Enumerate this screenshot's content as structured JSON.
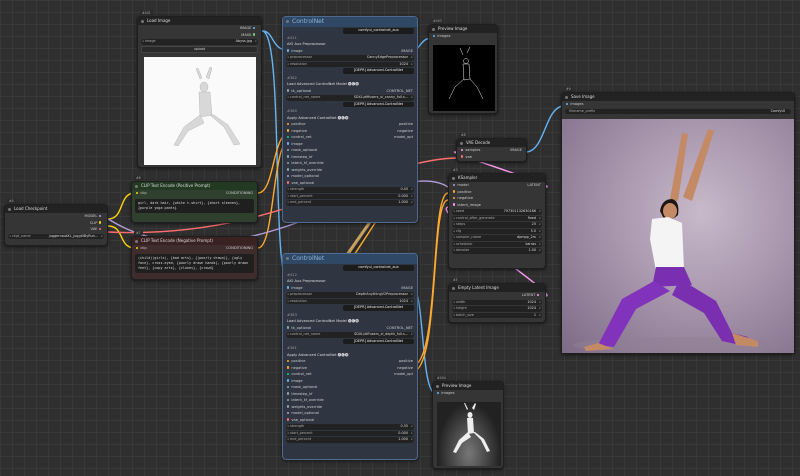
{
  "nodes": {
    "load_image": {
      "id": "#401",
      "title": "Load Image",
      "out1": "IMAGE",
      "out2": "MASK",
      "image_label": "image",
      "image_value": "Abyss.jpg",
      "upload_label": "upload"
    },
    "load_checkpoint": {
      "id": "#4",
      "title": "Load Checkpoint",
      "out1": "MODEL",
      "out2": "CLIP",
      "out3": "VAE",
      "ckpt_label": "ckpt_name",
      "ckpt_value": "juggernautXL_juggXIByRun..."
    },
    "clip_pos": {
      "id": "#6",
      "title": "CLIP Text Encode (Positive Prompt)",
      "in": "clip",
      "out": "CONDITIONING",
      "text": "girl, dark hair, {white t-shirt}, {short sleeves}, {purple yoga pants}"
    },
    "clip_neg": {
      "id": "#7",
      "title": "CLIP Text Encode (Negative Prompt)",
      "in": "clip",
      "out": "CONDITIONING",
      "text": "(child)(girls), {bad arts}, {(poorly drawn)}, {ugly face}, cross-eyed, {poorly drawn hands}, {poorly drawn feet}, {copy arts}, {clones}, {crowd}"
    },
    "group1": {
      "title": "ControlNet",
      "header_label": "comfyui_controlnet_aux",
      "id": "#411",
      "aux": {
        "title": "AIO Aux Preprocessor",
        "in": "image",
        "out": "IMAGE",
        "pre_label": "preprocessor",
        "pre_value": "CannyEdgePreprocessor",
        "res_label": "resolution",
        "res_value": "1024"
      },
      "header2": "[DEPR] Advanced-ControlNet",
      "id2": "#382",
      "loader": {
        "title": "Load Advanced ControlNet Model",
        "tag": "🅐🅒🅝",
        "in": "tk_optional",
        "out": "CONTROL_NET",
        "name_label": "control_net_name",
        "name_value": "SDXL\\diffusers_xl_canny_full.s..."
      },
      "header3": "[DEPR] Advanced-ControlNet",
      "id3": "#380",
      "apply": {
        "title": "Apply Advanced ControlNet",
        "tag": "🅐🅒🅝",
        "inputs": [
          "positive",
          "negative",
          "control_net",
          "image",
          "mask_optional",
          "timestep_kf",
          "latent_kf_override",
          "weights_override",
          "model_optional",
          "vae_optional"
        ],
        "outputs": [
          "positive",
          "negative",
          "model_opt"
        ],
        "strength_label": "strength",
        "strength_value": "0.45",
        "start_label": "start_percent",
        "start_value": "0.000",
        "end_label": "end_percent",
        "end_value": "1.000"
      }
    },
    "group2": {
      "title": "ControlNet",
      "header_label": "comfyui_controlnet_aux",
      "id": "#412",
      "aux": {
        "title": "AIO Aux Preprocessor",
        "in": "image",
        "out": "IMAGE",
        "pre_label": "preprocessor",
        "pre_value": "DepthAnythingV2Preprocessor",
        "res_label": "resolution",
        "res_value": "1024"
      },
      "header2": "[DEPR] Advanced-ControlNet",
      "id2": "#383",
      "loader": {
        "title": "Load Advanced ControlNet Model",
        "tag": "🅐🅒🅝",
        "in": "tk_optional",
        "out": "CONTROL_NET",
        "name_label": "control_net_name",
        "name_value": "SDXL\\diffusers_xl_depth_full.s..."
      },
      "header3": "[DEPR] Advanced-ControlNet",
      "id3": "#381",
      "apply": {
        "title": "Apply Advanced ControlNet",
        "tag": "🅐🅒🅝",
        "inputs": [
          "positive",
          "negative",
          "control_net",
          "image",
          "mask_optional",
          "timestep_kf",
          "latent_kf_override",
          "weights_override",
          "model_optional",
          "vae_optional"
        ],
        "outputs": [
          "positive",
          "negative",
          "model_opt"
        ],
        "strength_label": "strength",
        "strength_value": "0.35",
        "start_label": "start_percent",
        "start_value": "0.000",
        "end_label": "end_percent",
        "end_value": "1.000"
      }
    },
    "preview1": {
      "id": "#403",
      "title": "Preview Image",
      "in": "images"
    },
    "preview2": {
      "id": "#404",
      "title": "Preview Image",
      "in": "images"
    },
    "vae_decode": {
      "id": "#8",
      "title": "VAE Decode",
      "in1": "samples",
      "in2": "vae",
      "out": "IMAGE"
    },
    "ksampler": {
      "id": "#3",
      "title": "KSampler",
      "inputs": [
        "model",
        "positive",
        "negative",
        "latent_image"
      ],
      "out": "LATENT",
      "widgets": [
        {
          "label": "seed",
          "value": "797301132630186"
        },
        {
          "label": "control_after_generate",
          "value": "fixed"
        },
        {
          "label": "steps",
          "value": "25"
        },
        {
          "label": "cfg",
          "value": "5.0"
        },
        {
          "label": "sampler_name",
          "value": "dpmpp_2m"
        },
        {
          "label": "scheduler",
          "value": "karras"
        },
        {
          "label": "denoise",
          "value": "1.00"
        }
      ]
    },
    "empty_latent": {
      "id": "#5",
      "title": "Empty Latent Image",
      "out": "LATENT",
      "w_label": "width",
      "w_value": "1024",
      "h_label": "height",
      "h_value": "1024",
      "b_label": "batch_size",
      "b_value": "1"
    },
    "save_image": {
      "id": "#9",
      "title": "Save Image",
      "in": "images",
      "prefix_label": "filename_prefix",
      "prefix_value": "ComfyUI"
    }
  },
  "colors": {
    "wire_image": "#64b5f6",
    "wire_cond": "#ffa931",
    "wire_model": "#b39ddb",
    "wire_clip": "#ffd500",
    "wire_vae": "#ff6e6e",
    "wire_latent": "#ff9cf9",
    "wire_cn": "#00d78d"
  }
}
